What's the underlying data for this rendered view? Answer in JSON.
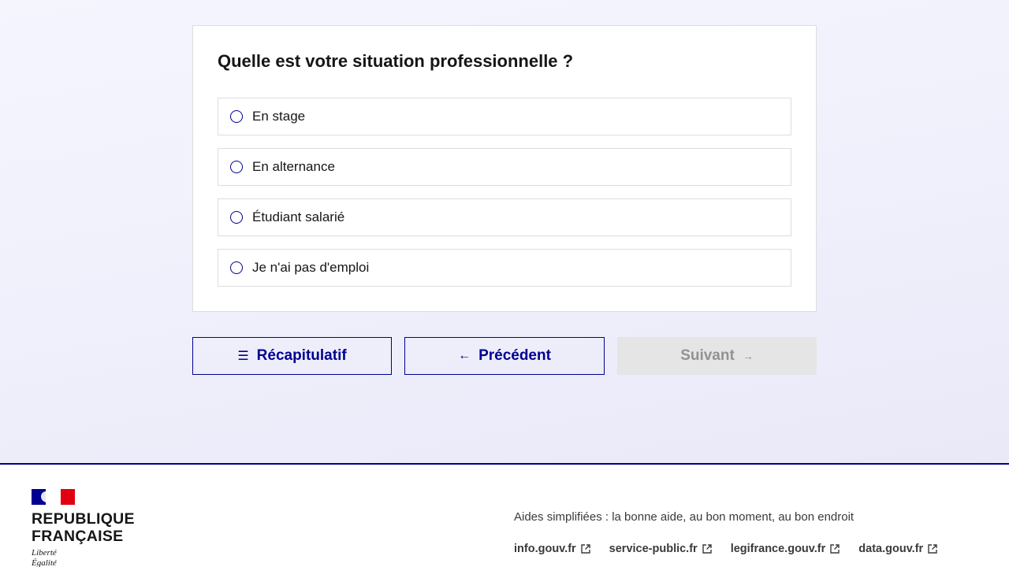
{
  "question": {
    "title": "Quelle est votre situation professionnelle ?",
    "options": [
      {
        "label": "En stage",
        "selected": false
      },
      {
        "label": "En alternance",
        "selected": false
      },
      {
        "label": "Étudiant salarié",
        "selected": false
      },
      {
        "label": "Je n'ai pas d'emploi",
        "selected": false
      }
    ]
  },
  "nav": {
    "recap_label": "Récapitulatif",
    "prev_label": "Précédent",
    "next_label": "Suivant",
    "next_disabled": true
  },
  "footer": {
    "brand_line1": "REPUBLIQUE",
    "brand_line2": "FRANÇAISE",
    "motto_line1": "Liberté",
    "motto_line2": "Égalité",
    "description": "Aides simplifiées : la bonne aide, au bon moment, au bon endroit",
    "links": [
      {
        "label": "info.gouv.fr"
      },
      {
        "label": "service-public.fr"
      },
      {
        "label": "legifrance.gouv.fr"
      },
      {
        "label": "data.gouv.fr"
      }
    ]
  },
  "colors": {
    "primary": "#000091",
    "disabled_bg": "#e5e5e5",
    "disabled_text": "#929292",
    "flag_red": "#e1000f"
  },
  "icons": {
    "recap": "list-icon",
    "prev": "arrow-left-icon",
    "next": "arrow-right-icon",
    "external": "external-link-icon"
  }
}
